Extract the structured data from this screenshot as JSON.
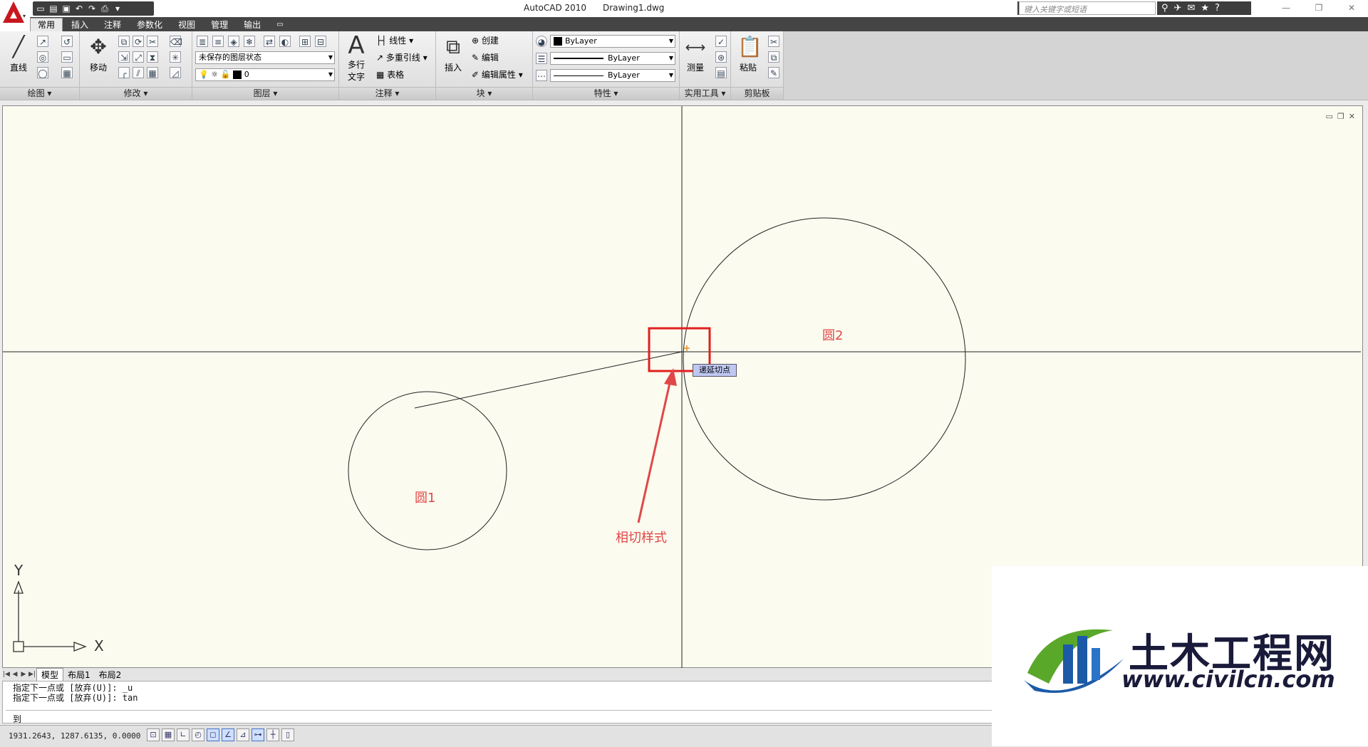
{
  "window": {
    "app_title": "AutoCAD 2010",
    "doc_title": "Drawing1.dwg",
    "search_placeholder": "键入关键字或短语"
  },
  "ribbon_tabs": [
    "常用",
    "插入",
    "注释",
    "参数化",
    "视图",
    "管理",
    "输出"
  ],
  "ribbon": {
    "draw": {
      "title": "绘图",
      "line_label": "直线"
    },
    "modify": {
      "title": "修改",
      "move_label": "移动"
    },
    "layers": {
      "title": "图层",
      "state_combo": "未保存的图层状态",
      "layer_combo": "0"
    },
    "annotation": {
      "title": "注释",
      "mtext_label_1": "多行",
      "mtext_label_2": "文字",
      "linear_label": "线性",
      "mleader_label": "多重引线",
      "table_label": "表格"
    },
    "block": {
      "title": "块",
      "insert_label": "插入",
      "create_label": "创建",
      "edit_label": "编辑",
      "edit_attr_label": "编辑属性"
    },
    "properties": {
      "title": "特性",
      "color_value": "ByLayer",
      "linetype_value": "ByLayer",
      "lineweight_value": "ByLayer"
    },
    "utilities": {
      "title": "实用工具",
      "measure_label": "测量"
    },
    "clipboard": {
      "title": "剪贴板",
      "paste_label": "粘贴"
    }
  },
  "drawing": {
    "circle1_label": "圆1",
    "circle2_label": "圆2",
    "annotation_label": "相切样式",
    "tooltip": "递延切点",
    "ucs_x": "X",
    "ucs_y": "Y",
    "annotation_color": "#e04848"
  },
  "layout_tabs": [
    "模型",
    "布局1",
    "布局2"
  ],
  "command": {
    "history_1": "指定下一点或 [放弃(U)]: _u",
    "history_2": "指定下一点或 [放弃(U)]: tan",
    "input": "到"
  },
  "status": {
    "coords": "1931.2643, 1287.6135, 0.0000"
  },
  "watermark": {
    "title": "土木工程网",
    "url": "www.civilcn.com"
  }
}
